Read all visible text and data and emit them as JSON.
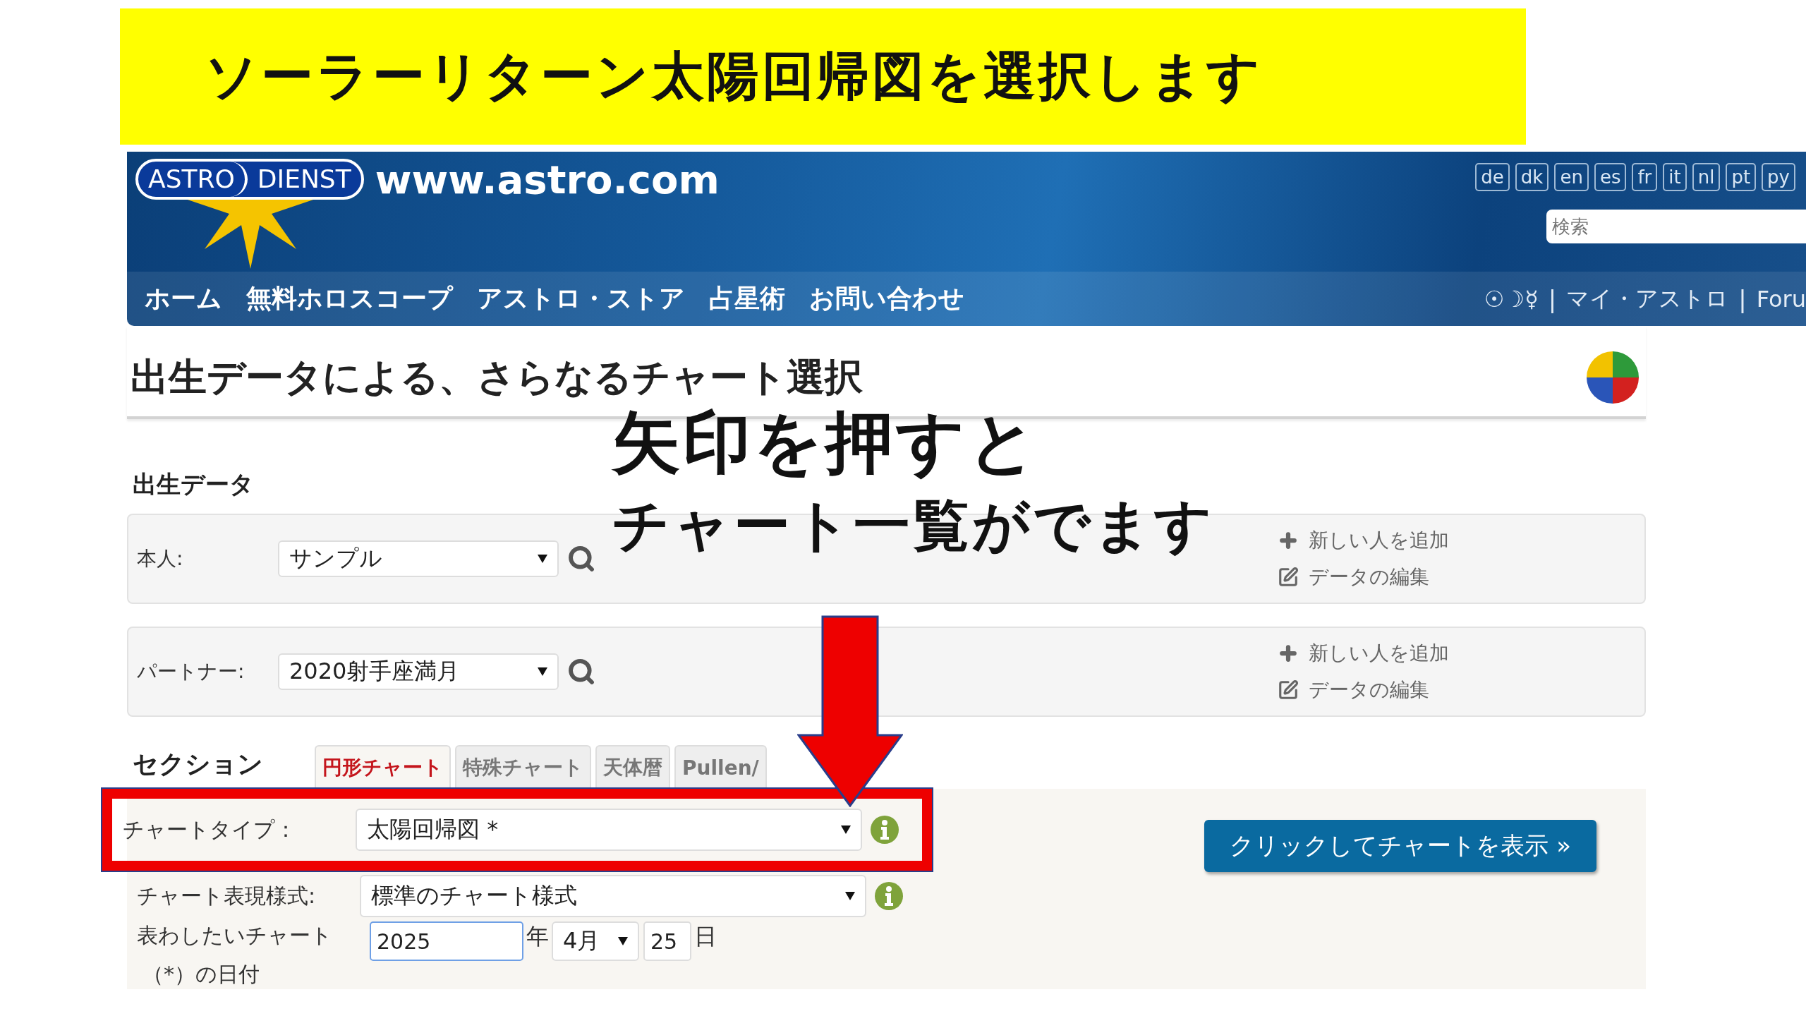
{
  "banner": {
    "text": "ソーラーリターン太陽回帰図を選択します"
  },
  "header": {
    "logo": [
      "ASTRO",
      "DIENST"
    ],
    "site": "www.astro.com",
    "languages": [
      "de",
      "dk",
      "en",
      "es",
      "fr",
      "it",
      "nl",
      "pt",
      "py"
    ],
    "search": {
      "placeholder": "検索"
    },
    "nav": [
      "ホーム",
      "無料ホロスコープ",
      "アストロ・ストア",
      "占星術",
      "お問い合わせ"
    ],
    "user_bar": [
      {
        "kind": "link",
        "text": "☉☽☿"
      },
      {
        "kind": "separator",
        "text": "|"
      },
      {
        "kind": "link",
        "text": "マイ・アストロ"
      },
      {
        "kind": "separator",
        "text": "|"
      },
      {
        "kind": "link",
        "text": "Foru"
      }
    ]
  },
  "page": {
    "title": "出生データによる、さらなるチャート選択"
  },
  "caption": [
    "矢印を押すと",
    "チャート一覧がでます"
  ],
  "birth_data": {
    "heading": "出生データ",
    "persons": [
      {
        "label": "本人:",
        "value": "サンプル",
        "links": [
          "新しい人を追加",
          "データの編集"
        ]
      },
      {
        "label": "パートナー:",
        "value": "2020射手座満月",
        "links": [
          "新しい人を追加",
          "データの編集"
        ]
      }
    ]
  },
  "section": {
    "label": "セクション",
    "tabs": [
      {
        "label": "円形チャート",
        "selected": true
      },
      {
        "label": "特殊チャート",
        "selected": false
      },
      {
        "label": "天体暦",
        "selected": false
      },
      {
        "label": "Pullen/",
        "selected": false
      }
    ]
  },
  "form": {
    "rows": [
      {
        "kind": "select",
        "label": "チャートタイプ：",
        "value": "太陽回帰図 *",
        "highlighted": true
      },
      {
        "kind": "select",
        "label": "チャート表現様式:",
        "value": "標準のチャート様式",
        "highlighted": false
      },
      {
        "kind": "date",
        "label": [
          "表わしたいチャート",
          "（*）の日付"
        ],
        "year": {
          "value": "2025",
          "focused": true
        },
        "year_unit": "年",
        "month": "4月",
        "day": "25",
        "day_unit": "日",
        "highlighted": false
      }
    ],
    "submit": "クリックしてチャートを表示 »"
  }
}
